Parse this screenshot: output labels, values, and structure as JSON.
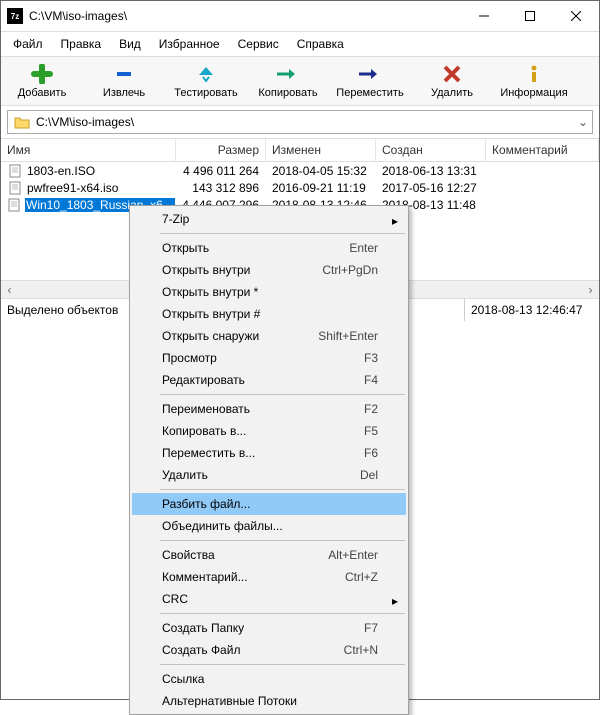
{
  "title": "C:\\VM\\iso-images\\",
  "menu": [
    "Файл",
    "Правка",
    "Вид",
    "Избранное",
    "Сервис",
    "Справка"
  ],
  "toolbar": [
    {
      "name": "add",
      "label": "Добавить"
    },
    {
      "name": "extract",
      "label": "Извлечь"
    },
    {
      "name": "test",
      "label": "Тестировать"
    },
    {
      "name": "copy",
      "label": "Копировать"
    },
    {
      "name": "move",
      "label": "Переместить"
    },
    {
      "name": "delete",
      "label": "Удалить"
    },
    {
      "name": "info",
      "label": "Информация"
    }
  ],
  "path": "C:\\VM\\iso-images\\",
  "columns": {
    "name": "Имя",
    "size": "Размер",
    "modified": "Изменен",
    "created": "Создан",
    "comment": "Комментарий"
  },
  "files": [
    {
      "name": "1803-en.ISO",
      "size": "4 496 011 264",
      "modified": "2018-04-05 15:32",
      "created": "2018-06-13 13:31"
    },
    {
      "name": "pwfree91-x64.iso",
      "size": "143 312 896",
      "modified": "2016-09-21 11:19",
      "created": "2017-05-16 12:27"
    },
    {
      "name": "Win10_1803_Russian_x6…",
      "size": "4 446 007 296",
      "modified": "2018-08-13 12:46",
      "created": "2018-08-13 11:48",
      "selected": true
    }
  ],
  "status": {
    "left": "Выделено объектов",
    "right": "2018-08-13 12:46:47"
  },
  "ctx": [
    {
      "t": "item",
      "label": "7-Zip",
      "sub": true
    },
    {
      "t": "sep"
    },
    {
      "t": "item",
      "label": "Открыть",
      "sc": "Enter"
    },
    {
      "t": "item",
      "label": "Открыть внутри",
      "sc": "Ctrl+PgDn"
    },
    {
      "t": "item",
      "label": "Открыть внутри *"
    },
    {
      "t": "item",
      "label": "Открыть внутри #"
    },
    {
      "t": "item",
      "label": "Открыть снаружи",
      "sc": "Shift+Enter"
    },
    {
      "t": "item",
      "label": "Просмотр",
      "sc": "F3"
    },
    {
      "t": "item",
      "label": "Редактировать",
      "sc": "F4"
    },
    {
      "t": "sep"
    },
    {
      "t": "item",
      "label": "Переименовать",
      "sc": "F2"
    },
    {
      "t": "item",
      "label": "Копировать в...",
      "sc": "F5"
    },
    {
      "t": "item",
      "label": "Переместить в...",
      "sc": "F6"
    },
    {
      "t": "item",
      "label": "Удалить",
      "sc": "Del"
    },
    {
      "t": "sep"
    },
    {
      "t": "item",
      "label": "Разбить файл...",
      "hover": true
    },
    {
      "t": "item",
      "label": "Объединить файлы..."
    },
    {
      "t": "sep"
    },
    {
      "t": "item",
      "label": "Свойства",
      "sc": "Alt+Enter"
    },
    {
      "t": "item",
      "label": "Комментарий...",
      "sc": "Ctrl+Z"
    },
    {
      "t": "item",
      "label": "CRC",
      "sub": true
    },
    {
      "t": "sep"
    },
    {
      "t": "item",
      "label": "Создать Папку",
      "sc": "F7"
    },
    {
      "t": "item",
      "label": "Создать Файл",
      "sc": "Ctrl+N"
    },
    {
      "t": "sep"
    },
    {
      "t": "item",
      "label": "Ссылка"
    },
    {
      "t": "item",
      "label": "Альтернативные Потоки"
    }
  ]
}
